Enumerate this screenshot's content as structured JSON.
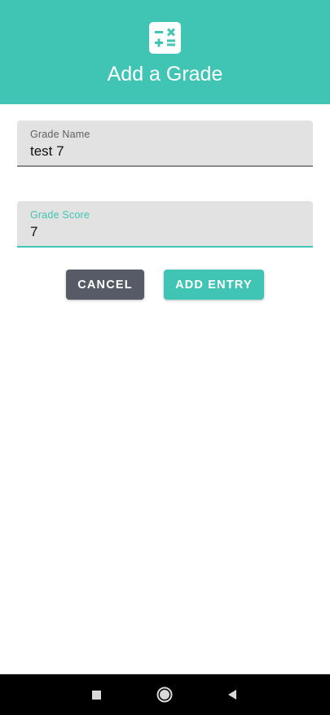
{
  "header": {
    "title": "Add a Grade",
    "icon": "calculator-icon",
    "background_color": "#40c4b4"
  },
  "form": {
    "grade_name": {
      "label": "Grade Name",
      "value": "test 7"
    },
    "grade_score": {
      "label": "Grade Score",
      "value": "7"
    }
  },
  "buttons": {
    "cancel_label": "CANCEL",
    "add_label": "ADD ENTRY"
  },
  "navigation_bar": {
    "items": [
      "recents-square-icon",
      "home-circle-icon",
      "back-triangle-icon"
    ]
  },
  "colors": {
    "accent": "#40c4b4",
    "cancel_button": "#575b68",
    "field_background": "#e2e2e2"
  }
}
